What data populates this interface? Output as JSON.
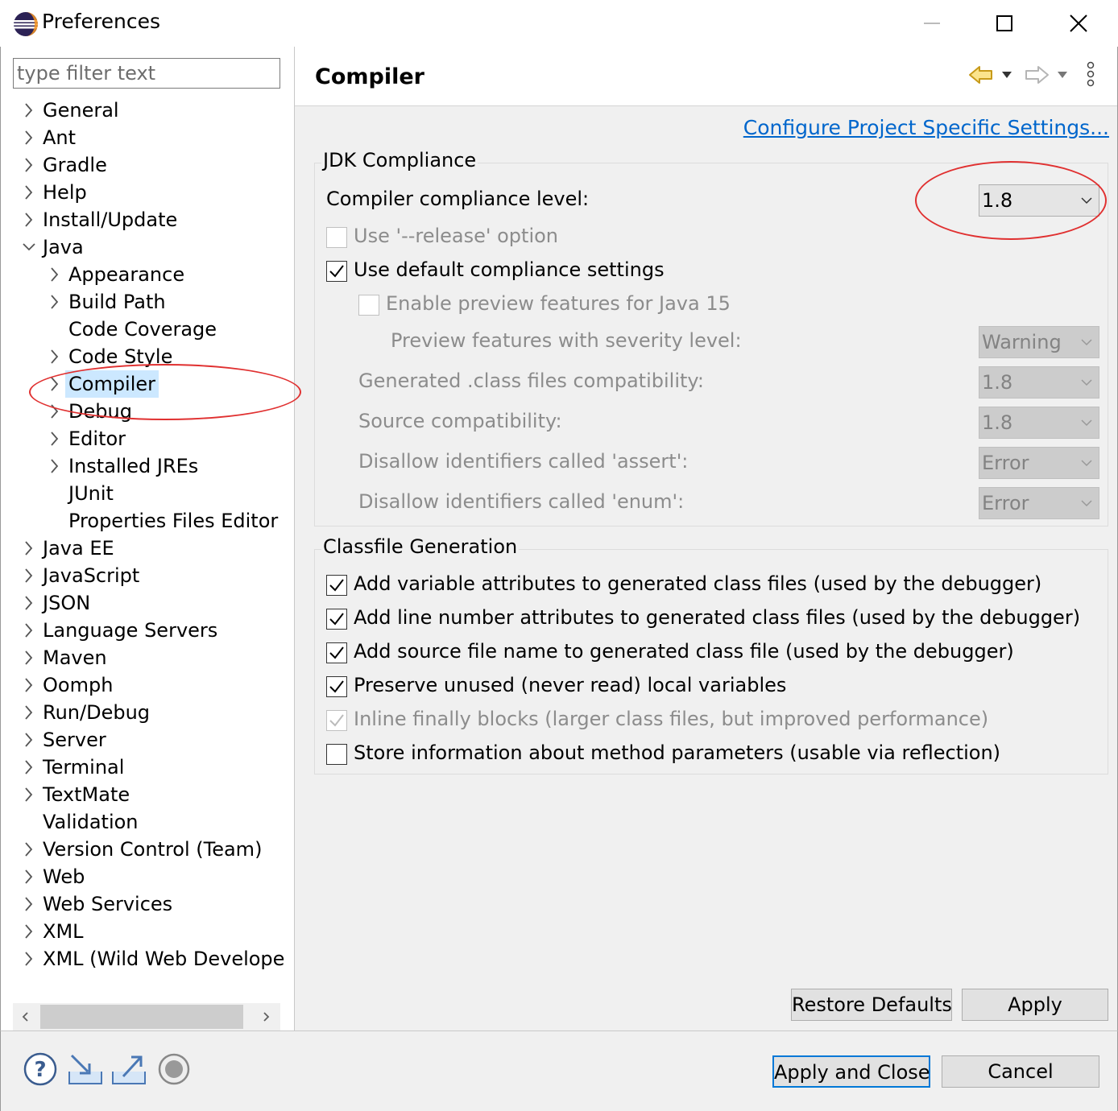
{
  "window": {
    "title": "Preferences"
  },
  "filter": {
    "placeholder": "type filter text"
  },
  "tree": [
    {
      "label": "General",
      "expand": "collapsed"
    },
    {
      "label": "Ant",
      "expand": "collapsed"
    },
    {
      "label": "Gradle",
      "expand": "collapsed"
    },
    {
      "label": "Help",
      "expand": "collapsed"
    },
    {
      "label": "Install/Update",
      "expand": "collapsed"
    },
    {
      "label": "Java",
      "expand": "expanded"
    },
    {
      "label": "Appearance",
      "expand": "collapsed"
    },
    {
      "label": "Build Path",
      "expand": "collapsed"
    },
    {
      "label": "Code Coverage",
      "expand": "none"
    },
    {
      "label": "Code Style",
      "expand": "collapsed"
    },
    {
      "label": "Compiler",
      "expand": "collapsed",
      "selected": true
    },
    {
      "label": "Debug",
      "expand": "collapsed"
    },
    {
      "label": "Editor",
      "expand": "collapsed"
    },
    {
      "label": "Installed JREs",
      "expand": "collapsed"
    },
    {
      "label": "JUnit",
      "expand": "none"
    },
    {
      "label": "Properties Files Editor",
      "expand": "none"
    },
    {
      "label": "Java EE",
      "expand": "collapsed"
    },
    {
      "label": "JavaScript",
      "expand": "collapsed"
    },
    {
      "label": "JSON",
      "expand": "collapsed"
    },
    {
      "label": "Language Servers",
      "expand": "collapsed"
    },
    {
      "label": "Maven",
      "expand": "collapsed"
    },
    {
      "label": "Oomph",
      "expand": "collapsed"
    },
    {
      "label": "Run/Debug",
      "expand": "collapsed"
    },
    {
      "label": "Server",
      "expand": "collapsed"
    },
    {
      "label": "Terminal",
      "expand": "collapsed"
    },
    {
      "label": "TextMate",
      "expand": "collapsed"
    },
    {
      "label": "Validation",
      "expand": "none"
    },
    {
      "label": "Version Control (Team)",
      "expand": "collapsed"
    },
    {
      "label": "Web",
      "expand": "collapsed"
    },
    {
      "label": "Web Services",
      "expand": "collapsed"
    },
    {
      "label": "XML",
      "expand": "collapsed"
    },
    {
      "label": "XML (Wild Web Develope",
      "expand": "collapsed"
    }
  ],
  "page": {
    "title": "Compiler",
    "config_link": "Configure Project Specific Settings..."
  },
  "jdk": {
    "title": "JDK Compliance",
    "compliance_label": "Compiler compliance level:",
    "compliance_value": "1.8",
    "release_label": "Use '--release' option",
    "release_checked": false,
    "default_label": "Use default compliance settings",
    "default_checked": true,
    "preview_label": "Enable preview features for Java 15",
    "preview_checked": false,
    "severity_label": "Preview features with severity level:",
    "severity_value": "Warning",
    "generated_label": "Generated .class files compatibility:",
    "generated_value": "1.8",
    "source_label": "Source compatibility:",
    "source_value": "1.8",
    "assert_label": "Disallow identifiers called 'assert':",
    "assert_value": "Error",
    "enum_label": "Disallow identifiers called 'enum':",
    "enum_value": "Error"
  },
  "classfile": {
    "title": "Classfile Generation",
    "options": [
      {
        "label": "Add variable attributes to generated class files (used by the debugger)",
        "checked": true,
        "enabled": true
      },
      {
        "label": "Add line number attributes to generated class files (used by the debugger)",
        "checked": true,
        "enabled": true
      },
      {
        "label": "Add source file name to generated class file (used by the debugger)",
        "checked": true,
        "enabled": true
      },
      {
        "label": "Preserve unused (never read) local variables",
        "checked": true,
        "enabled": true
      },
      {
        "label": "Inline finally blocks (larger class files, but improved performance)",
        "checked": true,
        "enabled": false
      },
      {
        "label": "Store information about method parameters (usable via reflection)",
        "checked": false,
        "enabled": true
      }
    ]
  },
  "buttons": {
    "restore": "Restore Defaults",
    "apply": "Apply",
    "apply_close": "Apply and Close",
    "cancel": "Cancel"
  },
  "colors": {
    "link": "#0066cc",
    "selection": "#cce8ff",
    "annotation": "#e03030",
    "panel": "#f0f0f0"
  }
}
